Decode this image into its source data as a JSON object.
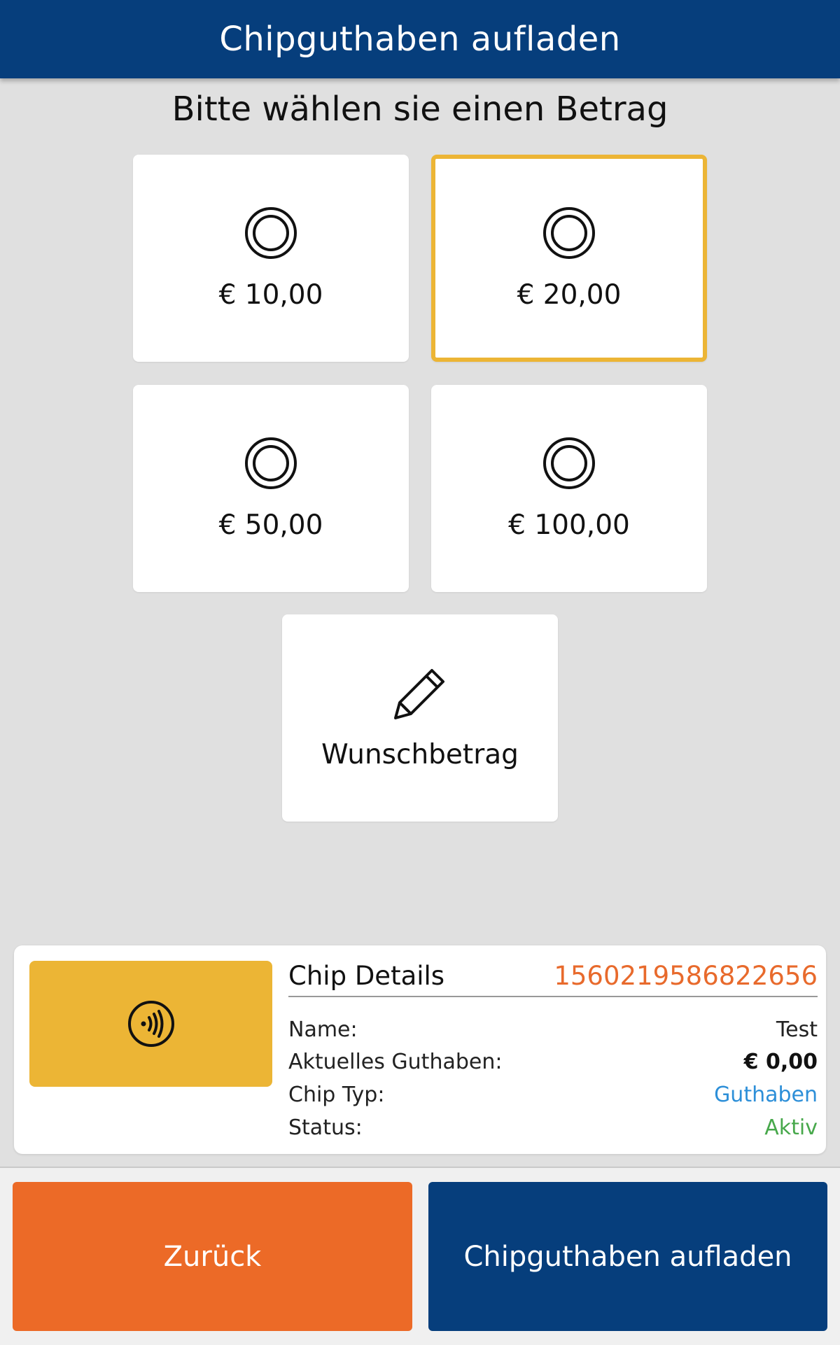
{
  "header": {
    "title": "Chipguthaben aufladen"
  },
  "prompt": "Bitte wählen sie einen Betrag",
  "amounts": [
    {
      "label": "€ 10,00",
      "selected": false
    },
    {
      "label": "€ 20,00",
      "selected": true
    },
    {
      "label": "€ 50,00",
      "selected": false
    },
    {
      "label": "€ 100,00",
      "selected": false
    }
  ],
  "custom_amount": {
    "label": "Wunschbetrag",
    "icon": "pencil-icon"
  },
  "chip": {
    "title": "Chip Details",
    "id": "1560219586822656",
    "icon": "nfc-contactless-icon",
    "rows": [
      {
        "label": "Name:",
        "value": "Test"
      },
      {
        "label": "Aktuelles Guthaben:",
        "value": "€ 0,00"
      },
      {
        "label": "Chip Typ:",
        "value": "Guthaben"
      },
      {
        "label": "Status:",
        "value": "Aktiv"
      }
    ]
  },
  "buttons": {
    "back": "Zurück",
    "charge": "Chipguthaben aufladen"
  },
  "colors": {
    "primary": "#063e7c",
    "accent_orange": "#ec6a27",
    "selection": "#ecb535",
    "chip_id": "#e86a2c",
    "type_blue": "#2d8fd8",
    "status_green": "#47a84b"
  }
}
